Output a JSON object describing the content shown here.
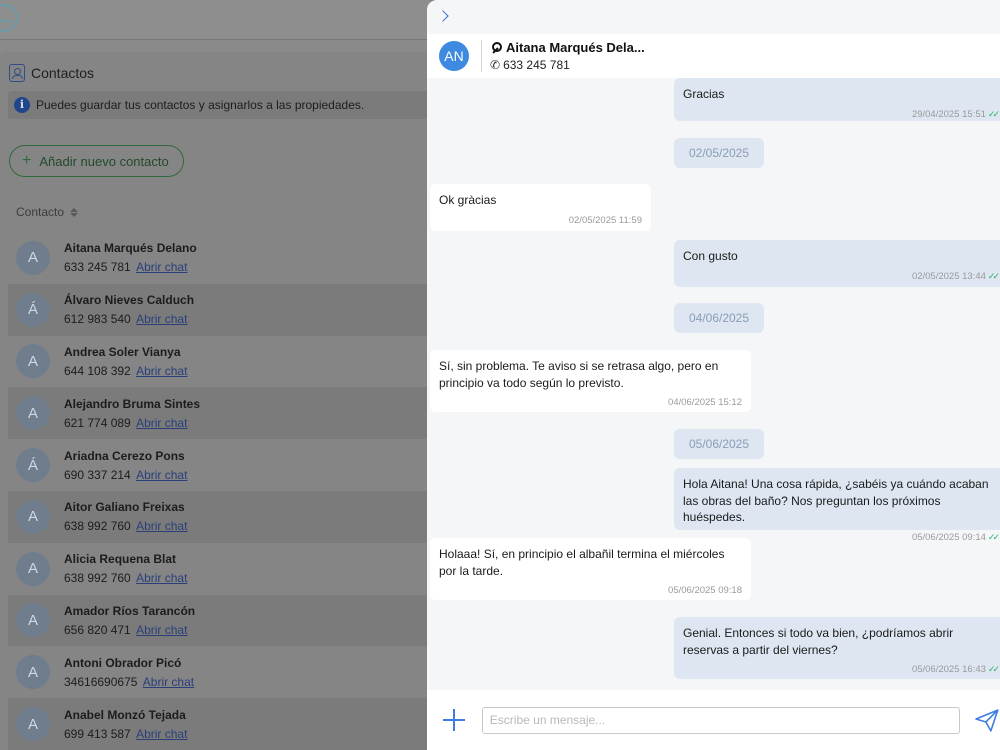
{
  "contacts_page": {
    "title": "Contactos",
    "info": "Puedes guardar tus contactos y asignarlos a las propiedades.",
    "add_button": "Añadir nuevo contacto",
    "column_header": "Contacto",
    "open_chat_label": "Abrir chat",
    "contacts": [
      {
        "initial": "A",
        "name": "Aitana Marqués Delano",
        "phone": "633 245 781"
      },
      {
        "initial": "Á",
        "name": "Álvaro Nieves Calduch",
        "phone": "612 983 540"
      },
      {
        "initial": "A",
        "name": "Andrea Soler Vianya",
        "phone": "644 108 392"
      },
      {
        "initial": "A",
        "name": "Alejandro Bruma Sintes",
        "phone": "621 774 089"
      },
      {
        "initial": "Á",
        "name": "Ariadna Cerezo Pons",
        "phone": "690 337 214"
      },
      {
        "initial": "A",
        "name": "Aitor Galiano Freixas",
        "phone": "638 992 760"
      },
      {
        "initial": "A",
        "name": "Alicia Requena Blat",
        "phone": "638 992 760"
      },
      {
        "initial": "A",
        "name": "Amador Ríos Tarancón",
        "phone": "656 820 471"
      },
      {
        "initial": "A",
        "name": "Antoni Obrador Picó",
        "phone": "34616690675"
      },
      {
        "initial": "A",
        "name": "Anabel Monzó Tejada",
        "phone": "699 413 587"
      }
    ]
  },
  "chat": {
    "avatar_initials": "AN",
    "contact_name": "Aitana Marqués Dela...",
    "contact_phone": "633 245 781",
    "input_placeholder": "Escribe un mensaje...",
    "colors": {
      "accent": "#3b7de0",
      "outgoing_bg": "#dde6f1",
      "read_check": "#27b46a"
    },
    "messages": [
      {
        "type": "out",
        "text": "Gracias",
        "time": "29/04/2025 15:51"
      },
      {
        "type": "date",
        "text": "02/05/2025"
      },
      {
        "type": "in",
        "text": "Ok gràcias",
        "time": "02/05/2025 11:59"
      },
      {
        "type": "out",
        "text": "Con gusto",
        "time": "02/05/2025 13:44"
      },
      {
        "type": "date",
        "text": "04/06/2025"
      },
      {
        "type": "in",
        "text": "Sí, sin problema. Te aviso si se retrasa algo, pero en principio va todo según lo previsto.",
        "time": "04/06/2025 15:12"
      },
      {
        "type": "date",
        "text": "05/06/2025"
      },
      {
        "type": "out",
        "text": "Hola Aitana! Una cosa rápida, ¿sabéis ya cuándo acaban las obras del baño? Nos preguntan los próximos huéspedes.",
        "time": "05/06/2025 09:14"
      },
      {
        "type": "in",
        "text": "Holaaa! Sí, en principio el albañil termina el miércoles por la tarde.",
        "time": "05/06/2025 09:18"
      },
      {
        "type": "out",
        "text": "Genial. Entonces si todo va bien, ¿podríamos abrir reservas a partir del viernes?",
        "time": "05/06/2025 16:43"
      }
    ]
  }
}
